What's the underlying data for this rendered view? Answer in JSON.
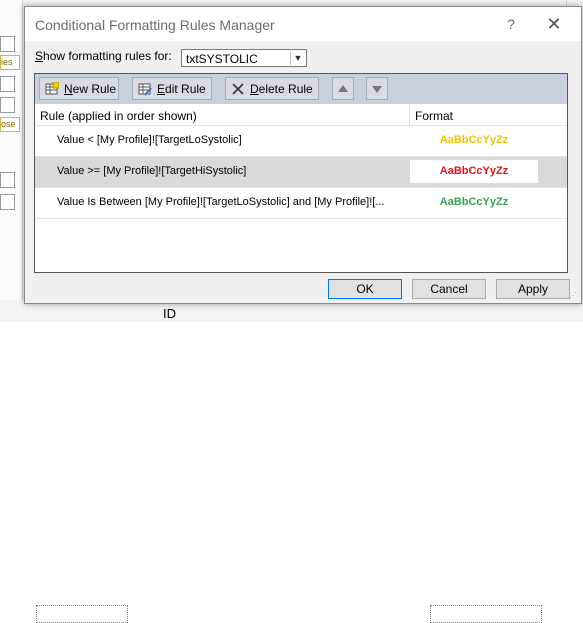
{
  "dialog": {
    "title": "Conditional Formatting Rules Manager",
    "help_label": "?",
    "close_label": "✕"
  },
  "show_rules": {
    "label_prefix": "",
    "label_mnemonic": "S",
    "label_rest": "how formatting rules for:",
    "selected_value": "txtSYSTOLIC"
  },
  "toolbar": {
    "new_rule_mnemonic": "N",
    "new_rule_rest": "ew Rule",
    "edit_rule_mnemonic": "E",
    "edit_rule_rest": "dit Rule",
    "delete_rule_mnemonic": "D",
    "delete_rule_rest": "elete Rule"
  },
  "columns": {
    "rule": "Rule (applied in order shown)",
    "format": "Format"
  },
  "rules": [
    {
      "text": "Value < [My Profile]![TargetLoSystolic]",
      "preview": "AaBbCcYyZz",
      "preview_color": "#f2c500",
      "selected": false
    },
    {
      "text": "Value >= [My Profile]![TargetHiSystolic]",
      "preview": "AaBbCcYyZz",
      "preview_color": "#e8131a",
      "selected": true
    },
    {
      "text": "Value Is Between [My Profile]![TargetLoSystolic]  and [My Profile]![...",
      "preview": "AaBbCcYyZz",
      "preview_color": "#3aa356",
      "selected": false
    }
  ],
  "buttons": {
    "ok": "OK",
    "cancel": "Cancel",
    "apply": "Apply"
  },
  "background": {
    "tag_top": "ies",
    "tag_mid": "ose",
    "id_label": "ID"
  }
}
